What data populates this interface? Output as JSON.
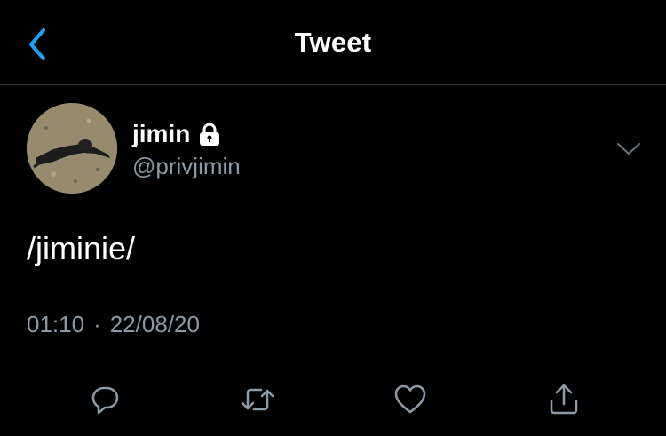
{
  "header": {
    "title": "Tweet",
    "back_icon": "chevron-left-icon"
  },
  "colors": {
    "accent": "#1da1f2",
    "background": "#000000",
    "text_primary": "#ffffff",
    "text_secondary": "#8b98a5",
    "divider": "#2f3336"
  },
  "tweet": {
    "author": {
      "display_name": "jimin",
      "handle": "@privjimin",
      "protected_icon": "lock-icon"
    },
    "text": "/jiminie/",
    "time": "01:10",
    "separator": "·",
    "date": "22/08/20"
  },
  "actions": [
    {
      "name": "reply",
      "icon": "reply-icon"
    },
    {
      "name": "retweet",
      "icon": "retweet-icon"
    },
    {
      "name": "like",
      "icon": "heart-icon"
    },
    {
      "name": "share",
      "icon": "share-icon"
    }
  ]
}
